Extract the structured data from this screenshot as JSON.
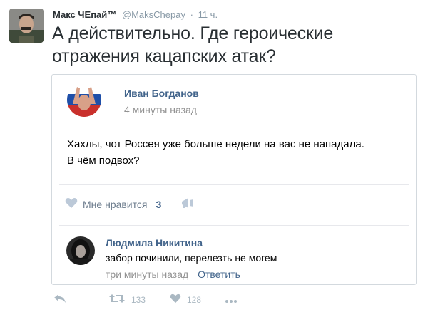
{
  "tweet": {
    "author_name": "Макс ЧЕпай™",
    "author_handle": "@MaksChepay",
    "separator": "·",
    "time": "11 ч.",
    "text": "А действительно. Где героические отражения кацапских атак?"
  },
  "vk_post": {
    "author": "Иван Богданов",
    "time": "4 минуты назад",
    "text_line1": "Хахлы, чот Россея уже больше недели на вас не нападала.",
    "text_line2": "В чём подвох?",
    "like_label": "Мне нравится",
    "like_count": "3",
    "comment": {
      "author": "Людмила Никитина",
      "text": "забор починили, перелезть не могем",
      "time": "три минуты назад",
      "reply_label": "Ответить"
    }
  },
  "tweet_actions": {
    "retweets": "133",
    "likes": "128"
  },
  "colors": {
    "vk_link": "#42648b",
    "muted": "#939393",
    "twitter_gray": "#aab8c2"
  },
  "icons": [
    "reply-icon",
    "retweet-icon",
    "heart-icon",
    "more-icon",
    "vk-heart-icon",
    "vk-share-icon"
  ]
}
